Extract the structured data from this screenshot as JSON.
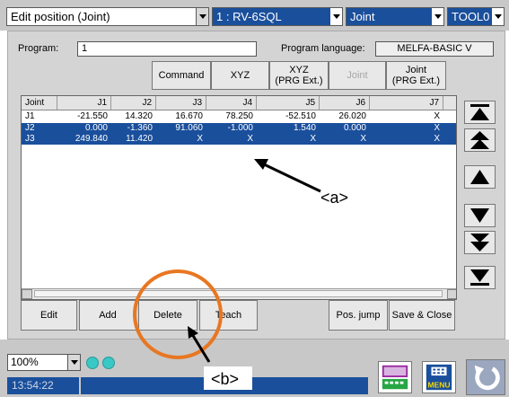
{
  "header": {
    "window_title": "Edit position (Joint)",
    "robot": "1 : RV-6SQL",
    "coord_mode": "Joint",
    "tool": "TOOL0"
  },
  "program": {
    "label": "Program:",
    "value": "1",
    "language_label": "Program language:",
    "language_value": "MELFA-BASIC V"
  },
  "view_buttons": {
    "command": "Command",
    "xyz": "XYZ",
    "xyz_prg": "XYZ\n(PRG Ext.)",
    "joint": "Joint",
    "joint_prg": "Joint\n(PRG Ext.)"
  },
  "table": {
    "columns": [
      "Joint",
      "J1",
      "J2",
      "J3",
      "J4",
      "J5",
      "J6",
      "J7"
    ],
    "rows": [
      [
        "J1",
        "-21.550",
        "14.320",
        "16.670",
        "78.250",
        "-52.510",
        "26.020",
        "X"
      ],
      [
        "J2",
        "0.000",
        "-1.360",
        "91.060",
        "-1.000",
        "1.540",
        "0.000",
        "X"
      ],
      [
        "J3",
        "249.840",
        "11.420",
        "X",
        "X",
        "X",
        "X",
        "X"
      ]
    ]
  },
  "actions": {
    "edit": "Edit",
    "add": "Add",
    "delete": "Delete",
    "teach": "Teach",
    "pos_jump": "Pos. jump",
    "save_close": "Save & Close"
  },
  "footer": {
    "zoom": "100%",
    "time": "13:54:22",
    "menu_label": "MENU"
  },
  "annotations": {
    "a": "<a>",
    "b": "<b>"
  },
  "colors": {
    "selection": "#1a4f9c",
    "annotation_circle": "#e87722",
    "status_led": "#38c9c6"
  }
}
